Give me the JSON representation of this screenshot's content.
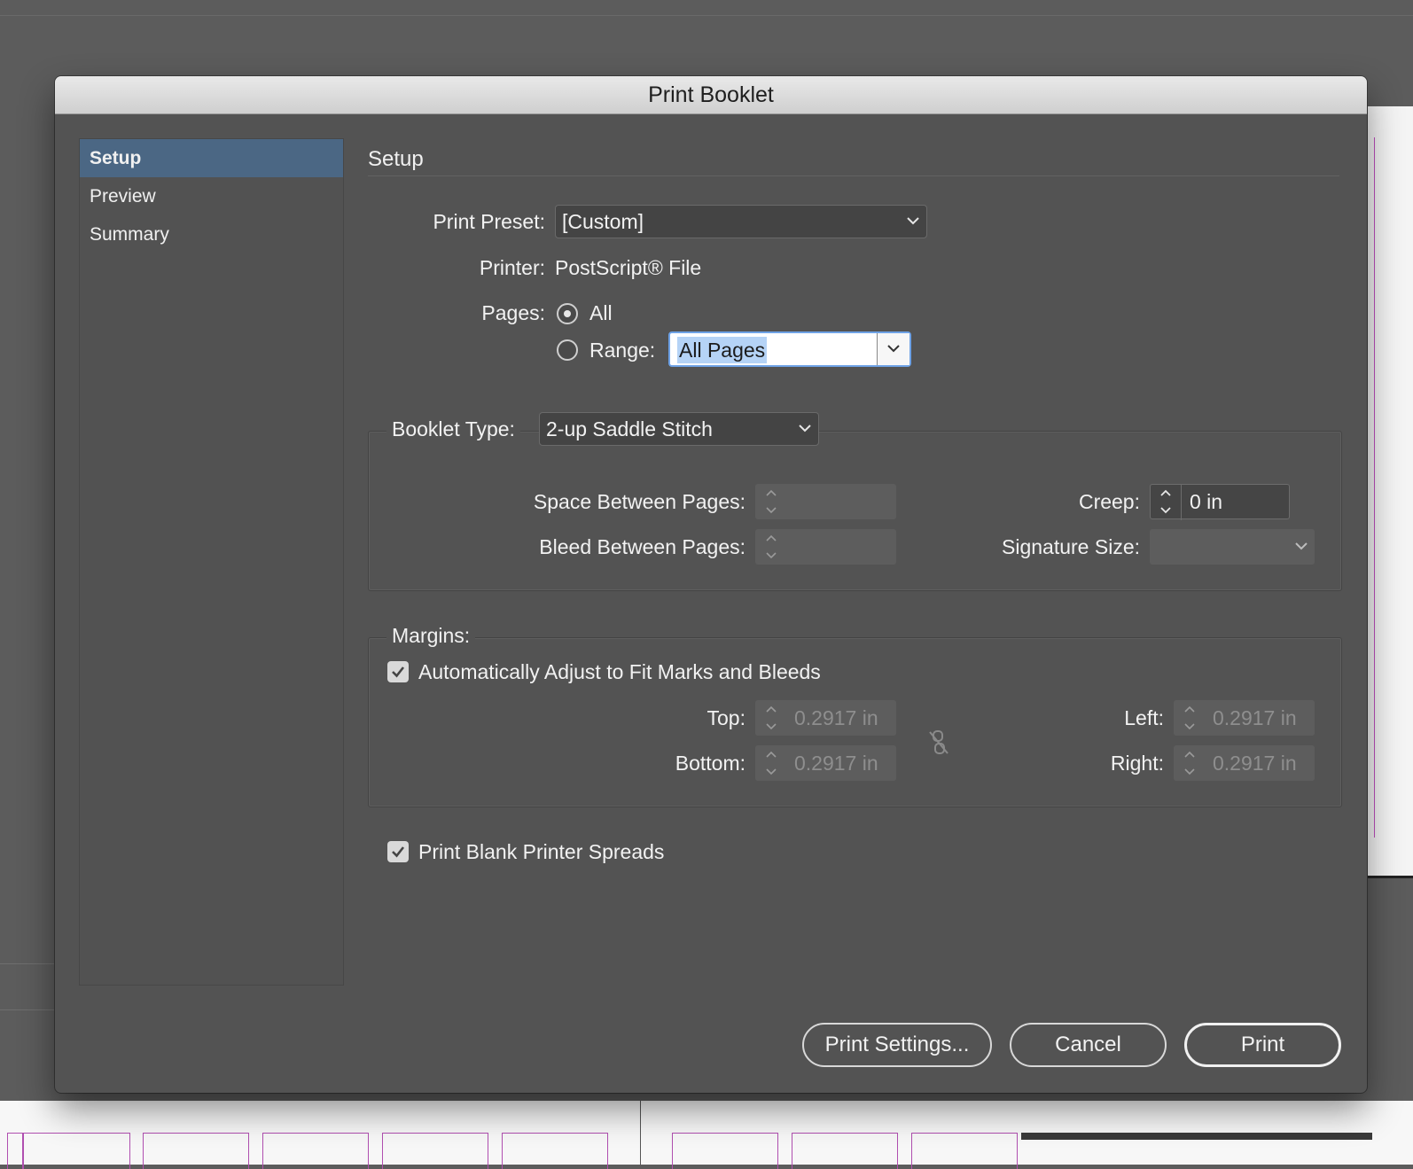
{
  "dialog": {
    "title": "Print Booklet"
  },
  "sidebar": {
    "items": [
      {
        "label": "Setup",
        "selected": true
      },
      {
        "label": "Preview",
        "selected": false
      },
      {
        "label": "Summary",
        "selected": false
      }
    ]
  },
  "content": {
    "title": "Setup",
    "print_preset": {
      "label": "Print Preset:",
      "value": "[Custom]"
    },
    "printer": {
      "label": "Printer:",
      "value": "PostScript® File"
    },
    "pages": {
      "label": "Pages:",
      "all_label": "All",
      "range_label": "Range:",
      "selected": "All",
      "range_value": "All Pages"
    },
    "booklet": {
      "type_label": "Booklet Type:",
      "type_value": "2-up Saddle Stitch",
      "space_between_label": "Space Between Pages:",
      "space_between_value": "",
      "bleed_between_label": "Bleed Between Pages:",
      "bleed_between_value": "",
      "creep_label": "Creep:",
      "creep_value": "0 in",
      "signature_label": "Signature Size:",
      "signature_value": ""
    },
    "margins": {
      "label": "Margins:",
      "auto_adjust_label": "Automatically Adjust to Fit Marks and Bleeds",
      "auto_adjust_checked": true,
      "top_label": "Top:",
      "top_value": "0.2917 in",
      "bottom_label": "Bottom:",
      "bottom_value": "0.2917 in",
      "left_label": "Left:",
      "left_value": "0.2917 in",
      "right_label": "Right:",
      "right_value": "0.2917 in"
    },
    "print_blank": {
      "label": "Print Blank Printer Spreads",
      "checked": true
    }
  },
  "buttons": {
    "print_settings": "Print Settings...",
    "cancel": "Cancel",
    "print": "Print"
  },
  "colors": {
    "selection": "#4b6784",
    "focus_ring": "#6ea2e6",
    "dialog_bg": "#535353"
  }
}
